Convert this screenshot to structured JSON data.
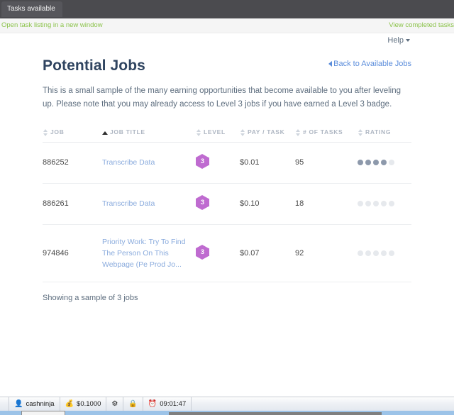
{
  "window": {
    "tab_title": "Tasks available"
  },
  "utilbar": {
    "left_link": "Open task listing in a new window",
    "right_link": "View completed tasks"
  },
  "helpbar": {
    "help_label": "Help",
    "caret_icon": "caret-down-icon"
  },
  "header": {
    "page_title": "Potential Jobs",
    "back_link": "Back to Available Jobs",
    "back_icon": "chevron-left-icon"
  },
  "lead_paragraph": "This is a small sample of the many earning opportunities that become available to you after leveling up. Please note that you may already access to Level 3 jobs if you have earned a Level 3 badge.",
  "table": {
    "columns": [
      {
        "label": "JOB",
        "sort": "both",
        "sort_icon": "sort-both-icon"
      },
      {
        "label": "JOB TITLE",
        "sort": "asc",
        "sort_icon": "sort-ascending-icon"
      },
      {
        "label": "LEVEL",
        "sort": "both",
        "sort_icon": "sort-both-icon"
      },
      {
        "label": "PAY / TASK",
        "sort": "both",
        "sort_icon": "sort-both-icon"
      },
      {
        "label": "# OF TASKS",
        "sort": "both",
        "sort_icon": "sort-both-icon"
      },
      {
        "label": "RATING",
        "sort": "both",
        "sort_icon": "sort-both-icon"
      }
    ],
    "rows": [
      {
        "job": "886252",
        "title": "Transcribe Data",
        "level": "3",
        "pay": "$0.01",
        "tasks": "95",
        "rating_filled": 4,
        "rating_total": 5
      },
      {
        "job": "886261",
        "title": "Transcribe Data",
        "level": "3",
        "pay": "$0.10",
        "tasks": "18",
        "rating_filled": 0,
        "rating_total": 5
      },
      {
        "job": "974846",
        "title": "Priority Work: Try To Find The Person On This Webpage (Pe Prod Jo...",
        "level": "3",
        "pay": "$0.07",
        "tasks": "92",
        "rating_filled": 0,
        "rating_total": 5
      }
    ]
  },
  "footer_note": "Showing a sample of 3 jobs",
  "taskbar": {
    "items": [
      {
        "label": "cashninja",
        "icon": "user-icon",
        "glyph": "👤"
      },
      {
        "label": "$0.1000",
        "icon": "coins-icon",
        "glyph": "💰"
      },
      {
        "label": "",
        "icon": "gear-icon",
        "glyph": "⚙"
      },
      {
        "label": "",
        "icon": "lock-icon",
        "glyph": "🔒"
      },
      {
        "label": "09:01:47",
        "icon": "clock-icon",
        "glyph": "⏰"
      }
    ]
  },
  "colors": {
    "titlebar": "#4b4b4f",
    "green_link": "#8bc34a",
    "blue_link": "#5b8ddb",
    "heading": "#2f4460",
    "badge_purple": "#bf6bd0",
    "rating_filled": "#8d99ab",
    "rating_empty": "#e6e9ed"
  }
}
